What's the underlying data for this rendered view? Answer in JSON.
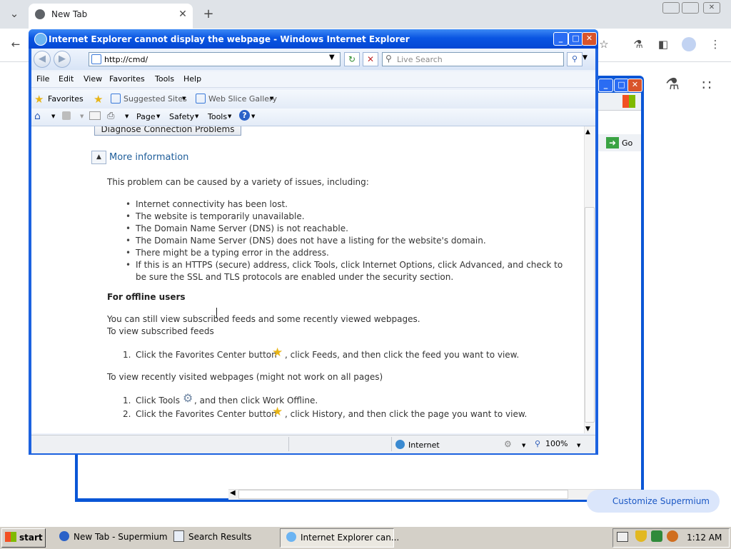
{
  "chrome": {
    "tab_title": "New Tab",
    "toolbar_icons": [
      "back-icon",
      "star-icon",
      "flask-icon",
      "sidebar-icon",
      "profile-icon",
      "kebab-menu-icon"
    ]
  },
  "back_window": {
    "go_label": "Go"
  },
  "customize_chip": "Customize Supermium",
  "ie": {
    "title": "Internet Explorer cannot display the webpage - Windows Internet Explorer",
    "address": "http://cmd/",
    "search_placeholder": "Live Search",
    "menu": [
      "File",
      "Edit",
      "View",
      "Favorites",
      "Tools",
      "Help"
    ],
    "favorites_label": "Favorites",
    "suggested_sites": "Suggested Sites",
    "web_slice_gallery": "Web Slice Gallery",
    "cmd": {
      "page": "Page",
      "safety": "Safety",
      "tools": "Tools"
    },
    "diagnose_button": "Diagnose Connection Problems",
    "more_info": "More information",
    "cause_intro": "This problem can be caused by a variety of issues, including:",
    "causes": [
      "Internet connectivity has been lost.",
      "The website is temporarily unavailable.",
      "The Domain Name Server (DNS) is not reachable.",
      "The Domain Name Server (DNS) does not have a listing for the website's domain.",
      "There might be a typing error in the address.",
      "If this is an HTTPS (secure) address, click Tools, click Internet Options, click Advanced, and check to be sure the SSL and TLS protocols are enabled under the security section."
    ],
    "offline_heading": "For offline users",
    "offline_text1": "You can still view subscribed feeds and some recently viewed webpages.",
    "offline_text2": "To view subscribed feeds",
    "feeds_step_num": "1.",
    "feeds_step_a": "Click the Favorites Center button",
    "feeds_step_b": ", click Feeds, and then click the feed you want to view.",
    "recent_heading": "To view recently visited webpages (might not work on all pages)",
    "recent_steps": [
      {
        "num": "1.",
        "a": "Click Tools",
        "b": ", and then click Work Offline."
      },
      {
        "num": "2.",
        "a": "Click the Favorites Center button",
        "b": ", click History, and then click the page you want to view."
      }
    ],
    "status": {
      "zone": "Internet",
      "zoom": "100%"
    }
  },
  "taskbar": {
    "start": "start",
    "buttons": [
      "New Tab - Supermium",
      "Search Results",
      "Internet Explorer can..."
    ],
    "clock": "1:12 AM"
  }
}
